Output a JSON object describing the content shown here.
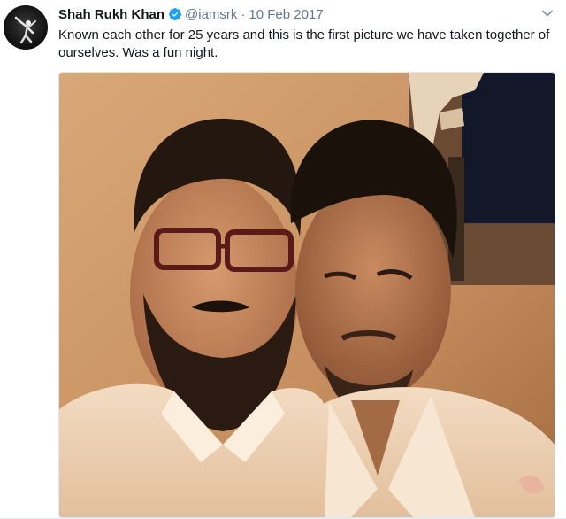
{
  "tweet": {
    "author_name": "Shah Rukh Khan",
    "verified": true,
    "handle": "@iamsrk",
    "separator": "·",
    "date": "10 Feb 2017",
    "text": "Known each other for 25 years and this is the first picture we have taken together of ourselves. Was a fun night."
  },
  "icons": {
    "avatar": "profile-avatar",
    "verified": "verified-badge-icon",
    "menu": "chevron-down-icon"
  },
  "colors": {
    "verified_blue": "#1da1f2",
    "secondary_text": "#657786",
    "primary_text": "#14171a"
  }
}
